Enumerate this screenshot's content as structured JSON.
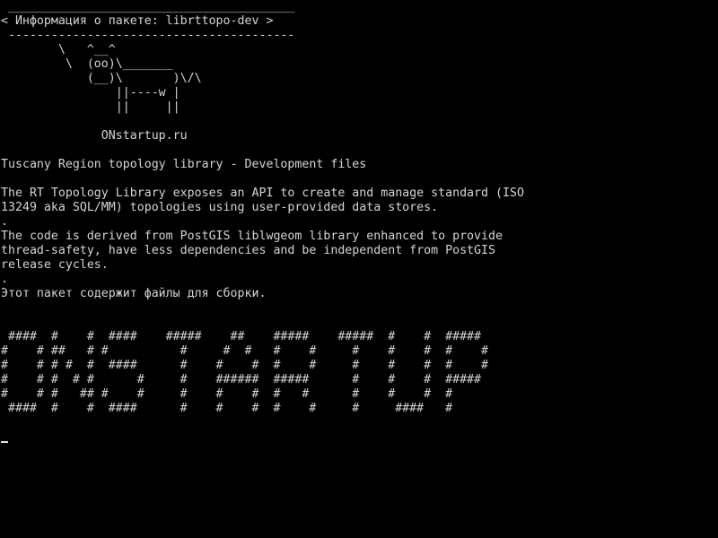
{
  "terminal": {
    "fg_color": "#d4d4d4",
    "bg_color": "#000000",
    "lines": [
      " ________________________________________",
      "< Информация о пакете: librttopo-dev >",
      " ----------------------------------------",
      "        \\   ^__^",
      "         \\  (oo)\\_______",
      "            (__)\\       )\\/\\",
      "                ||----w |",
      "                ||     ||",
      "",
      "              ONstartup.ru",
      "",
      "Tuscany Region topology library - Development files",
      "",
      "The RT Topology Library exposes an API to create and manage standard (ISO",
      "13249 aka SQL/MM) topologies using user-provided data stores.",
      ".",
      "The code is derived from PostGIS liblwgeom library enhanced to provide",
      "thread-safety, have less dependencies and be independent from PostGIS",
      "release cycles.",
      ".",
      "Этот пакет содержит файлы для сборки.",
      "",
      "",
      " ####  #    #  ####    #####    ##    #####    #####  #    #  #####",
      "#    # ##   # #          #     #  #   #    #     #    #    #  #    #",
      "#    # # #  #  ####      #    #    #  #    #     #    #    #  #    #",
      "#    # #  # #      #     #    ######  #####      #    #    #  #####",
      "#    # #   ## #    #     #    #    #  #   #      #    #    #  #",
      " ####  #    #  ####      #    #    #  #    #     #     ####   #",
      ""
    ]
  }
}
